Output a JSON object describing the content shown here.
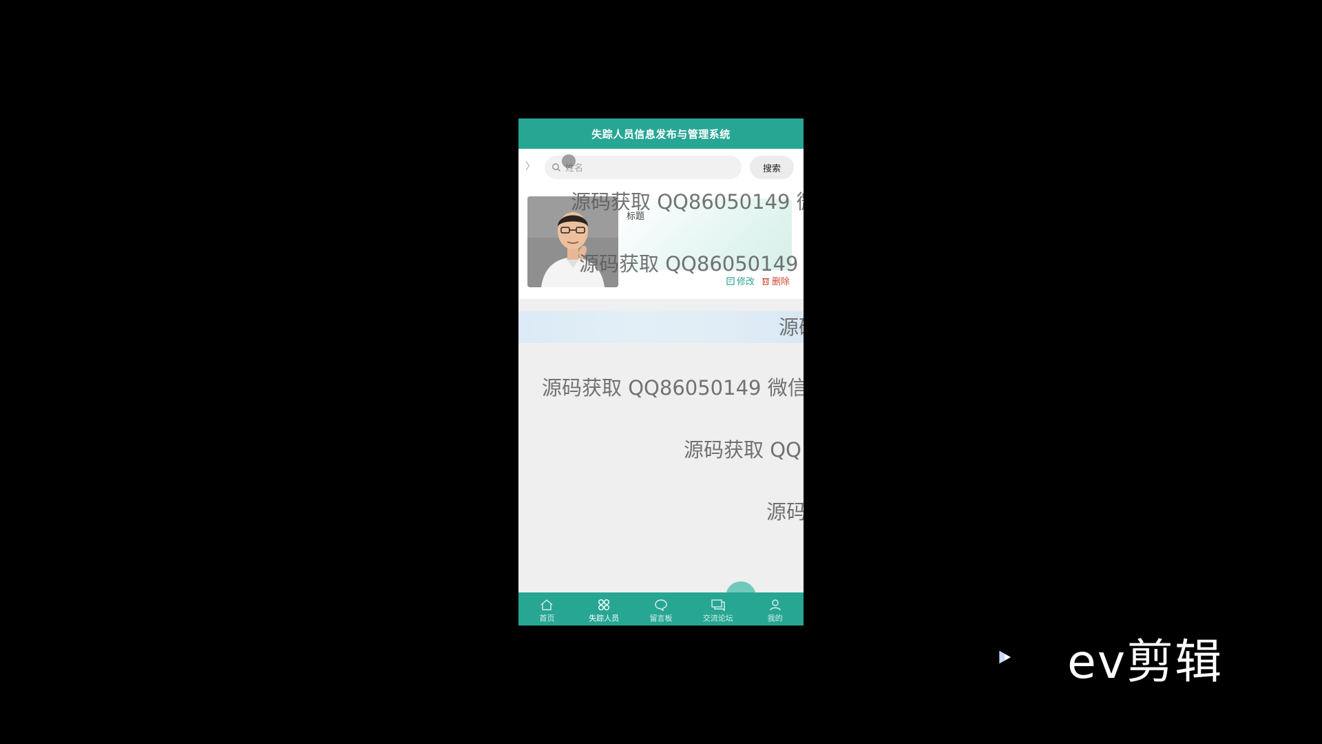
{
  "header": {
    "title": "失踪人员信息发布与管理系统"
  },
  "search": {
    "placeholder": "姓名",
    "button_label": "搜索"
  },
  "card": {
    "title_label": "标题",
    "edit_label": "修改",
    "delete_label": "删除"
  },
  "watermarks": [
    "源码获取 QQ86050149 微",
    "源码获取 QQ86050149",
    "源码",
    "源码获取 QQ86050149 微信",
    "源码获取 QQ",
    "源码"
  ],
  "tabbar": {
    "items": [
      {
        "label": "首页",
        "icon": "home-icon"
      },
      {
        "label": "失踪人员",
        "icon": "grid-icon"
      },
      {
        "label": "留言板",
        "icon": "chat-bubble-icon"
      },
      {
        "label": "交流论坛",
        "icon": "forum-icon"
      },
      {
        "label": "我的",
        "icon": "user-icon"
      }
    ],
    "active_index": 1
  },
  "overlay_brand": {
    "text": "ev剪辑",
    "icon": "play-triangle-icon"
  },
  "colors": {
    "primary": "#27a694",
    "delete": "#d14a30",
    "background": "#000000",
    "page": "#efefef"
  }
}
